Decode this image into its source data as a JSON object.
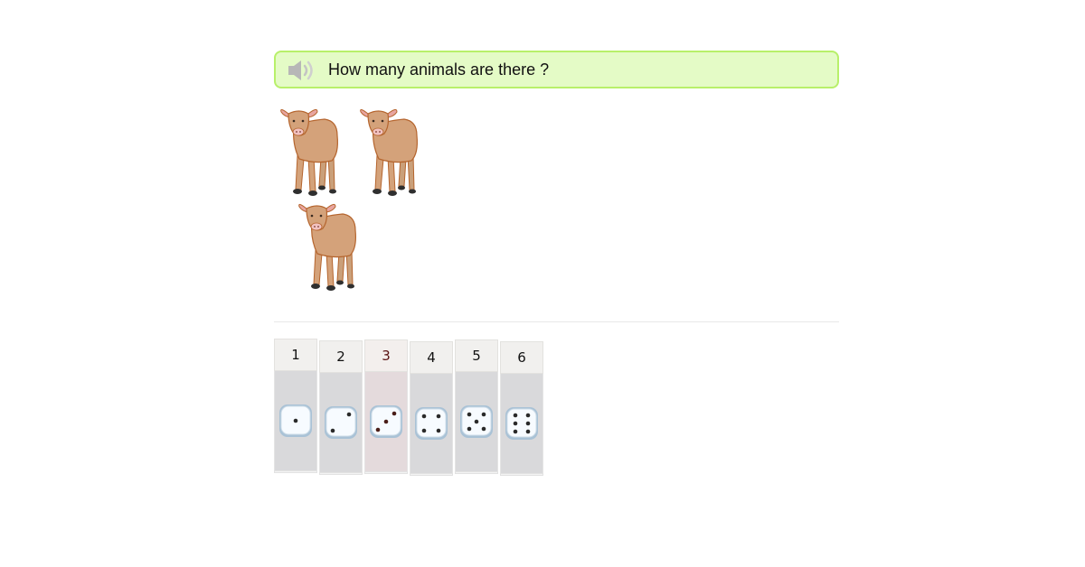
{
  "question": {
    "text": "How many animals are there ?",
    "audio_icon": "speaker-icon"
  },
  "animals": {
    "kind": "calf",
    "count": 3
  },
  "answers": [
    {
      "label": "1",
      "dots": 1,
      "selected": false
    },
    {
      "label": "2",
      "dots": 2,
      "selected": false
    },
    {
      "label": "3",
      "dots": 3,
      "selected": true
    },
    {
      "label": "4",
      "dots": 4,
      "selected": false
    },
    {
      "label": "5",
      "dots": 5,
      "selected": false
    },
    {
      "label": "6",
      "dots": 6,
      "selected": false
    }
  ],
  "colors": {
    "question_bg": "#e4fbc6",
    "question_border": "#b8f06a",
    "cow_body": "#d4a27a",
    "cow_outline": "#b5652e"
  }
}
